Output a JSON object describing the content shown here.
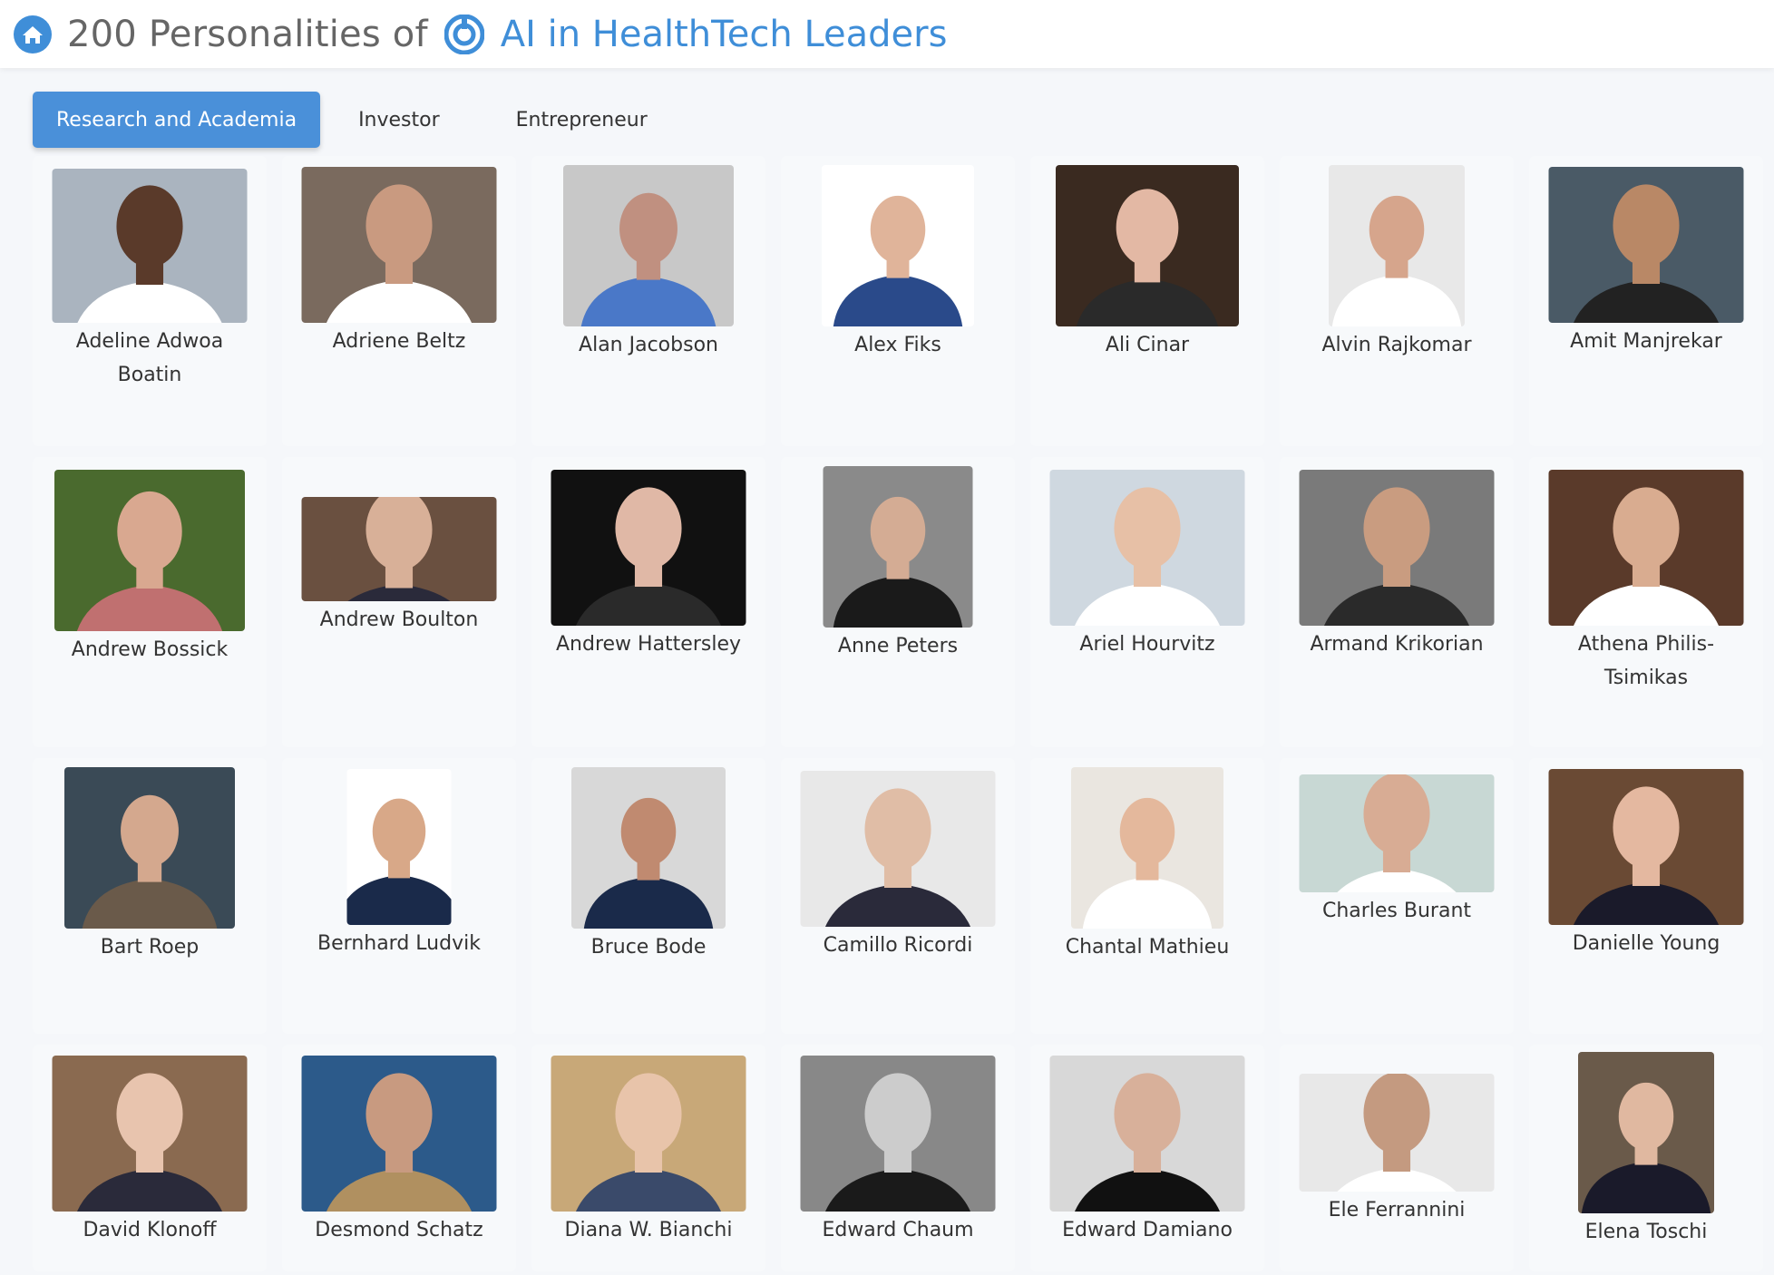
{
  "header": {
    "title_prefix": "200 Personalities of",
    "category": "AI in HealthTech Leaders",
    "accent_color": "#3f8ed8"
  },
  "tabs": [
    {
      "label": "Research and Academia",
      "active": true
    },
    {
      "label": "Investor",
      "active": false
    },
    {
      "label": "Entrepreneur",
      "active": false
    }
  ],
  "people": [
    {
      "name": "Adeline Adwoa Boatin"
    },
    {
      "name": "Adriene Beltz"
    },
    {
      "name": "Alan Jacobson"
    },
    {
      "name": "Alex Fiks"
    },
    {
      "name": "Ali Cinar"
    },
    {
      "name": "Alvin Rajkomar"
    },
    {
      "name": "Amit Manjrekar"
    },
    {
      "name": "Andrew Bossick"
    },
    {
      "name": "Andrew Boulton"
    },
    {
      "name": "Andrew Hattersley"
    },
    {
      "name": "Anne Peters"
    },
    {
      "name": "Ariel Hourvitz"
    },
    {
      "name": "Armand Krikorian"
    },
    {
      "name": "Athena Philis-Tsimikas"
    },
    {
      "name": "Bart Roep"
    },
    {
      "name": "Bernhard Ludvik"
    },
    {
      "name": "Bruce Bode"
    },
    {
      "name": "Camillo Ricordi"
    },
    {
      "name": "Chantal Mathieu"
    },
    {
      "name": "Charles Burant"
    },
    {
      "name": "Danielle Young"
    },
    {
      "name": "David Klonoff"
    },
    {
      "name": "Desmond Schatz"
    },
    {
      "name": "Diana W. Bianchi"
    },
    {
      "name": "Edward Chaum"
    },
    {
      "name": "Edward Damiano"
    },
    {
      "name": "Ele Ferrannini"
    },
    {
      "name": "Elena Toschi"
    }
  ]
}
